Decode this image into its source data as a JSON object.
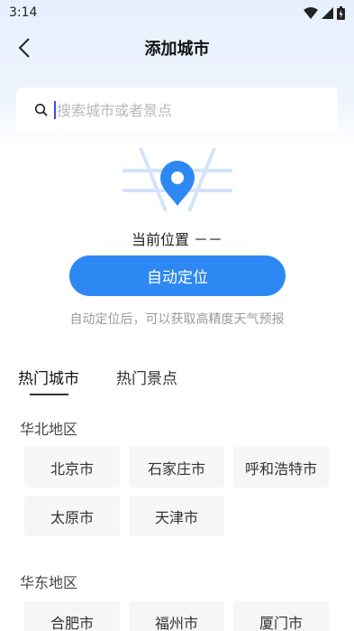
{
  "status_bar": {
    "time": "3:14"
  },
  "header": {
    "title": "添加城市"
  },
  "search": {
    "placeholder": "搜索城市或者景点",
    "value": ""
  },
  "location": {
    "label": "当前位置",
    "value": "－－",
    "auto_button": "自动定位",
    "hint": "自动定位后，可以获取高精度天气预报"
  },
  "tabs": [
    {
      "label": "热门城市",
      "active": true
    },
    {
      "label": "热门景点",
      "active": false
    }
  ],
  "sections": [
    {
      "title": "华北地区",
      "cities": [
        "北京市",
        "石家庄市",
        "呼和浩特市",
        "太原市",
        "天津市"
      ]
    },
    {
      "title": "华东地区",
      "cities": [
        "合肥市",
        "福州市",
        "厦门市"
      ]
    }
  ],
  "colors": {
    "accent": "#2d88f3",
    "header_bg": "#e6f0fd",
    "city_bg": "#f6f6f6"
  }
}
